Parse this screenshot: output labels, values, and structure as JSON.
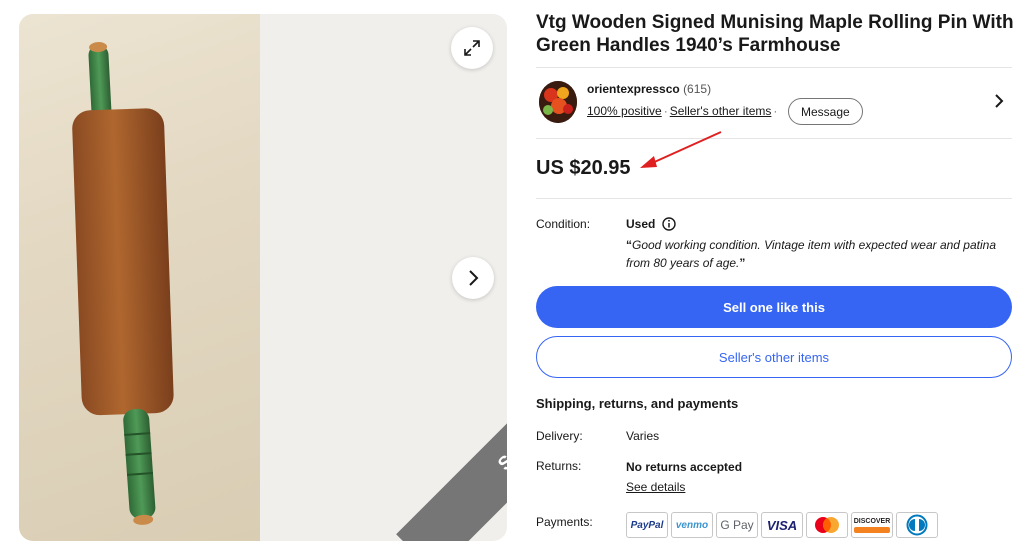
{
  "item": {
    "title": "Vtg Wooden Signed Munising Maple Rolling Pin With Green Handles 1940’s Farmhouse",
    "sold_label": "SOLD"
  },
  "seller": {
    "name": "orientexpressco",
    "feedback_count": "(615)",
    "positive": "100% positive",
    "other_items_link": "Seller's other items",
    "message_label": "Message"
  },
  "price": "US $20.95",
  "condition": {
    "label": "Condition:",
    "value": "Used",
    "note_open": "“",
    "note": "Good working condition. Vintage item with expected wear and patina from 80 years of age.",
    "note_close": "”"
  },
  "buttons": {
    "sell_one": "Sell one like this",
    "sellers_other_items": "Seller's other items"
  },
  "shipping": {
    "section_title": "Shipping, returns, and payments",
    "delivery_label": "Delivery:",
    "delivery_value": "Varies",
    "returns_label": "Returns:",
    "returns_value": "No returns accepted",
    "see_details": "See details",
    "payments_label": "Payments:"
  },
  "payment_methods": {
    "paypal": "PayPal",
    "venmo": "venmo",
    "gpay": "G Pay",
    "visa": "VISA",
    "discover": "DISCOVER"
  },
  "colors": {
    "primary": "#3665f3",
    "sold_banner": "#767676",
    "arrow": "#e02020"
  }
}
